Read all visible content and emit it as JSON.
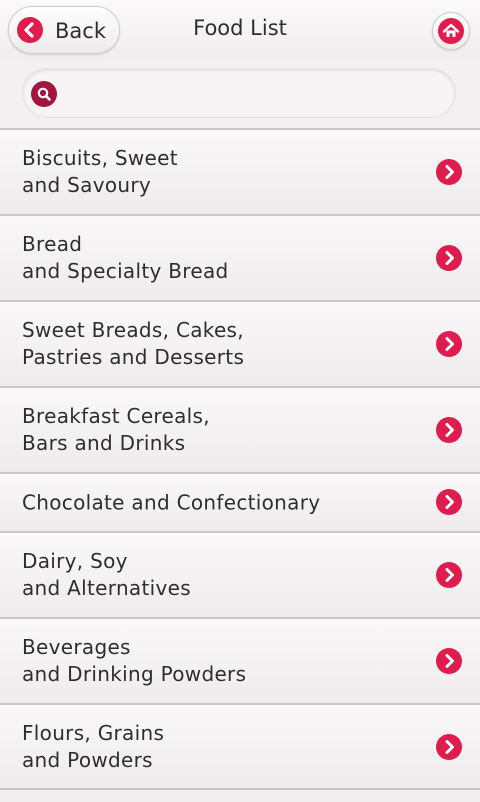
{
  "header": {
    "back_label": "Back",
    "title": "Food List",
    "home_icon": "home-icon",
    "back_icon": "chevron-left-icon"
  },
  "search": {
    "placeholder": "",
    "value": "",
    "icon": "search-icon"
  },
  "colors": {
    "accent": "#e01c4e",
    "background": "#f3f0f1",
    "text": "#2e2e2e"
  },
  "food_categories": [
    {
      "label": "Biscuits, Sweet\nand Savoury"
    },
    {
      "label": "Bread\nand Specialty Bread"
    },
    {
      "label": "Sweet Breads, Cakes,\nPastries and Desserts"
    },
    {
      "label": "Breakfast Cereals,\nBars and Drinks"
    },
    {
      "label": "Chocolate and Confectionary"
    },
    {
      "label": "Dairy, Soy\nand Alternatives"
    },
    {
      "label": "Beverages\nand Drinking Powders"
    },
    {
      "label": "Flours, Grains\nand Powders"
    }
  ]
}
